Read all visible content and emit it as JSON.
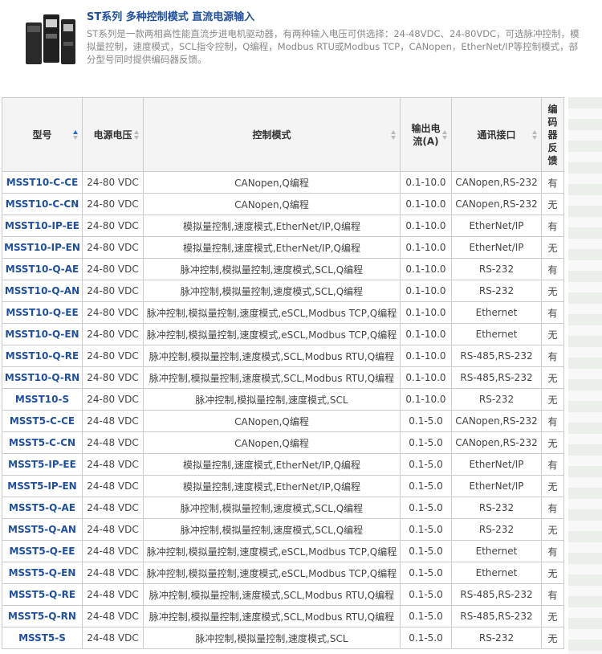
{
  "header": {
    "title": "ST系列 多种控制模式 直流电源输入",
    "description": "ST系列是一款两相高性能直流步进电机驱动器，有两种输入电压可供选择：24-48VDC、24-80VDC，可选脉冲控制，模拟量控制，速度模式，SCL指令控制，Q编程，Modbus RTU或Modbus TCP，CANopen，EtherNet/IP等控制模式，部分型号同时提供编码器反馈。"
  },
  "table": {
    "columns": [
      "型号",
      "电源电压",
      "控制模式",
      "输出电流(A)",
      "通讯接口",
      "编码器反馈"
    ],
    "rows": [
      [
        "MSST10-C-CE",
        "24-80 VDC",
        "CANopen,Q编程",
        "0.1-10.0",
        "CANopen,RS-232",
        "有"
      ],
      [
        "MSST10-C-CN",
        "24-80 VDC",
        "CANopen,Q编程",
        "0.1-10.0",
        "CANopen,RS-232",
        "无"
      ],
      [
        "MSST10-IP-EE",
        "24-80 VDC",
        "模拟量控制,速度模式,EtherNet/IP,Q编程",
        "0.1-10.0",
        "EtherNet/IP",
        "有"
      ],
      [
        "MSST10-IP-EN",
        "24-80 VDC",
        "模拟量控制,速度模式,EtherNet/IP,Q编程",
        "0.1-10.0",
        "EtherNet/IP",
        "无"
      ],
      [
        "MSST10-Q-AE",
        "24-80 VDC",
        "脉冲控制,模拟量控制,速度模式,SCL,Q编程",
        "0.1-10.0",
        "RS-232",
        "有"
      ],
      [
        "MSST10-Q-AN",
        "24-80 VDC",
        "脉冲控制,模拟量控制,速度模式,SCL,Q编程",
        "0.1-10.0",
        "RS-232",
        "无"
      ],
      [
        "MSST10-Q-EE",
        "24-80 VDC",
        "脉冲控制,模拟量控制,速度模式,eSCL,Modbus TCP,Q编程",
        "0.1-10.0",
        "Ethernet",
        "有"
      ],
      [
        "MSST10-Q-EN",
        "24-80 VDC",
        "脉冲控制,模拟量控制,速度模式,eSCL,Modbus TCP,Q编程",
        "0.1-10.0",
        "Ethernet",
        "无"
      ],
      [
        "MSST10-Q-RE",
        "24-80 VDC",
        "脉冲控制,模拟量控制,速度模式,SCL,Modbus RTU,Q编程",
        "0.1-10.0",
        "RS-485,RS-232",
        "有"
      ],
      [
        "MSST10-Q-RN",
        "24-80 VDC",
        "脉冲控制,模拟量控制,速度模式,SCL,Modbus RTU,Q编程",
        "0.1-10.0",
        "RS-485,RS-232",
        "无"
      ],
      [
        "MSST10-S",
        "24-80 VDC",
        "脉冲控制,模拟量控制,速度模式,SCL",
        "0.1-10.0",
        "RS-232",
        "无"
      ],
      [
        "MSST5-C-CE",
        "24-48 VDC",
        "CANopen,Q编程",
        "0.1-5.0",
        "CANopen,RS-232",
        "有"
      ],
      [
        "MSST5-C-CN",
        "24-48 VDC",
        "CANopen,Q编程",
        "0.1-5.0",
        "CANopen,RS-232",
        "无"
      ],
      [
        "MSST5-IP-EE",
        "24-48 VDC",
        "模拟量控制,速度模式,EtherNet/IP,Q编程",
        "0.1-5.0",
        "EtherNet/IP",
        "有"
      ],
      [
        "MSST5-IP-EN",
        "24-48 VDC",
        "模拟量控制,速度模式,EtherNet/IP,Q编程",
        "0.1-5.0",
        "EtherNet/IP",
        "无"
      ],
      [
        "MSST5-Q-AE",
        "24-48 VDC",
        "脉冲控制,模拟量控制,速度模式,SCL,Q编程",
        "0.1-5.0",
        "RS-232",
        "有"
      ],
      [
        "MSST5-Q-AN",
        "24-48 VDC",
        "脉冲控制,模拟量控制,速度模式,SCL,Q编程",
        "0.1-5.0",
        "RS-232",
        "无"
      ],
      [
        "MSST5-Q-EE",
        "24-48 VDC",
        "脉冲控制,模拟量控制,速度模式,eSCL,Modbus TCP,Q编程",
        "0.1-5.0",
        "Ethernet",
        "有"
      ],
      [
        "MSST5-Q-EN",
        "24-48 VDC",
        "脉冲控制,模拟量控制,速度模式,eSCL,Modbus TCP,Q编程",
        "0.1-5.0",
        "Ethernet",
        "无"
      ],
      [
        "MSST5-Q-RE",
        "24-48 VDC",
        "脉冲控制,模拟量控制,速度模式,SCL,Modbus RTU,Q编程",
        "0.1-5.0",
        "RS-485,RS-232",
        "有"
      ],
      [
        "MSST5-Q-RN",
        "24-48 VDC",
        "脉冲控制,模拟量控制,速度模式,SCL,Modbus RTU,Q编程",
        "0.1-5.0",
        "RS-485,RS-232",
        "无"
      ],
      [
        "MSST5-S",
        "24-48 VDC",
        "脉冲控制,模拟量控制,速度模式,SCL",
        "0.1-5.0",
        "RS-232",
        "无"
      ]
    ]
  },
  "colors": {
    "title": "#1f4f9e",
    "model_link": "#1f4f9e",
    "sort_active": "#1f6fd6"
  },
  "icons": {
    "sort": "sort-arrows-icon",
    "product": "driver-product-image"
  }
}
